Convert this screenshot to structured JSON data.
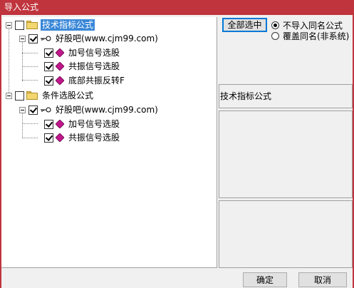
{
  "window": {
    "title": "导入公式"
  },
  "tree": [
    {
      "id": "root1",
      "label": "技术指标公式",
      "checked": false,
      "selected": true
    },
    {
      "id": "site1",
      "label": "好股吧(www.cjm99.com)",
      "checked": true
    },
    {
      "id": "f1",
      "label": "加号信号选股",
      "checked": true
    },
    {
      "id": "f2",
      "label": "共振信号选股",
      "checked": true
    },
    {
      "id": "f3",
      "label": "底部共振反转F",
      "checked": true
    },
    {
      "id": "root2",
      "label": "条件选股公式",
      "checked": false
    },
    {
      "id": "site2",
      "label": "好股吧(www.cjm99.com)",
      "checked": true
    },
    {
      "id": "f4",
      "label": "加号信号选股",
      "checked": true
    },
    {
      "id": "f5",
      "label": "共振信号选股",
      "checked": true
    }
  ],
  "options": {
    "select_all_label": "全部选中",
    "radio_no_import": "不导入同名公式",
    "radio_overwrite": "覆盖同名(非系统)",
    "selected_radio": "no_import"
  },
  "info": {
    "category_label": "技术指标公式"
  },
  "footer": {
    "ok_label": "确定",
    "cancel_label": "取消"
  },
  "colors": {
    "titlebar": "#c0343d",
    "selection": "#3a88d8",
    "diamond": "#c0178c"
  }
}
